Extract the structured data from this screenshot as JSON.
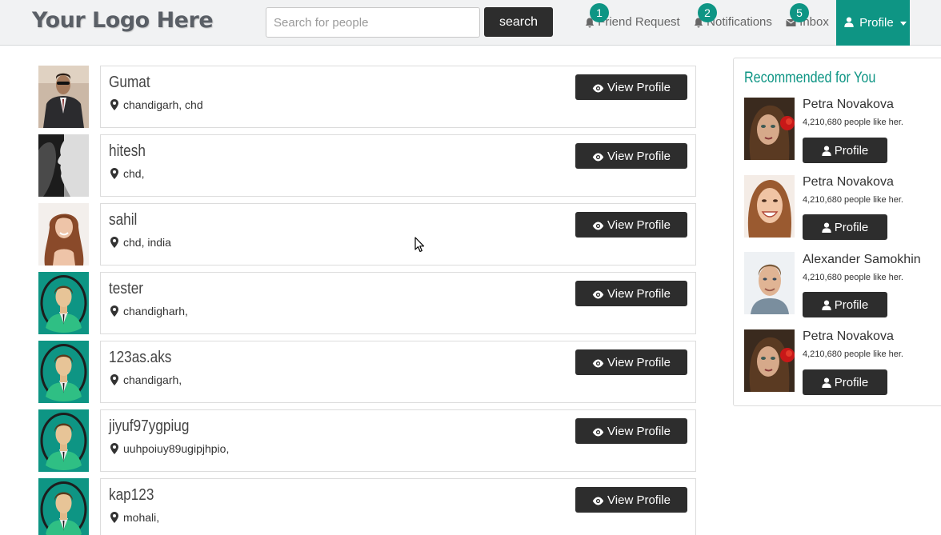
{
  "header": {
    "logo": "Your Logo Here",
    "search_placeholder": "Search for people",
    "search_button": "search",
    "nav": [
      {
        "label": "Friend Request",
        "badge": "1"
      },
      {
        "label": "Notifications",
        "badge": "2"
      },
      {
        "label": "Inbox",
        "badge": "5"
      }
    ],
    "profile_label": "Profile"
  },
  "people": [
    {
      "name": "Gumat",
      "location": "chandigarh, chd",
      "button": "View Profile",
      "avatar": "photo-man-suit"
    },
    {
      "name": "hitesh",
      "location": "chd,",
      "button": "View Profile",
      "avatar": "photo-face-profile"
    },
    {
      "name": "sahil",
      "location": "chd, india",
      "button": "View Profile",
      "avatar": "photo-woman"
    },
    {
      "name": "tester",
      "location": "chandigharh,",
      "button": "View Profile",
      "avatar": "default-avatar"
    },
    {
      "name": "123as.aks",
      "location": "chandigarh,",
      "button": "View Profile",
      "avatar": "default-avatar"
    },
    {
      "name": "jiyuf97ygpiug",
      "location": "uuhpoiuy89ugipjhpio,",
      "button": "View Profile",
      "avatar": "default-avatar"
    },
    {
      "name": "kap123",
      "location": "mohali,",
      "button": "View Profile",
      "avatar": "default-avatar"
    }
  ],
  "recommended": {
    "title": "Recommended for You",
    "items": [
      {
        "name": "Petra Novakova",
        "likes": "4,210,680 people like her.",
        "button": "Profile",
        "avatar": "photo-woman-rose"
      },
      {
        "name": "Petra Novakova",
        "likes": "4,210,680 people like her.",
        "button": "Profile",
        "avatar": "photo-woman-smile"
      },
      {
        "name": "Alexander Samokhin",
        "likes": "4,210,680 people like her.",
        "button": "Profile",
        "avatar": "photo-man"
      },
      {
        "name": "Petra Novakova",
        "likes": "4,210,680 people like her.",
        "button": "Profile",
        "avatar": "photo-woman-rose"
      }
    ]
  },
  "colors": {
    "accent": "#0e9584",
    "button_dark": "#2d2d2d",
    "navbar_bg": "#f1f2f3"
  }
}
